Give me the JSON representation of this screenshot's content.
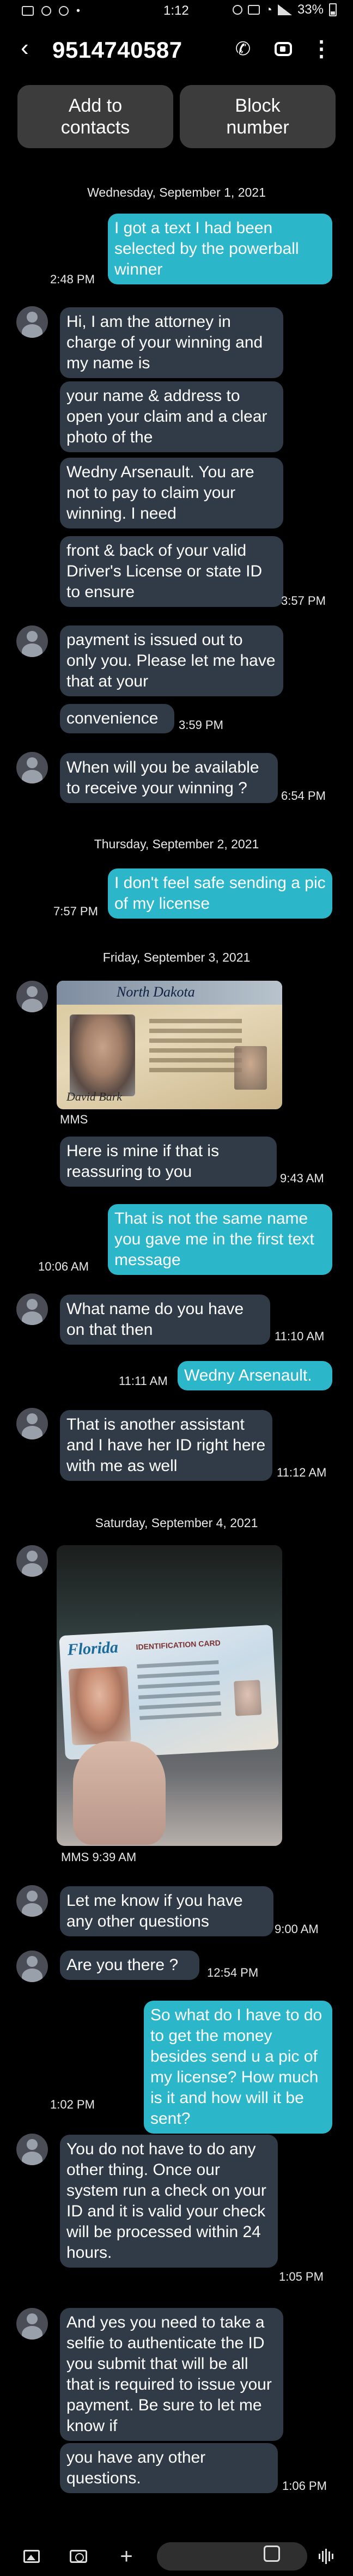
{
  "status_bar": {
    "time": "1:12",
    "battery": "33%"
  },
  "header": {
    "title": "9514740587",
    "add_to_contacts": "Add to contacts",
    "block_number": "Block number"
  },
  "dates": {
    "d1": "Wednesday, September 1, 2021",
    "d2": "Thursday, September 2, 2021",
    "d3": "Friday, September 3, 2021",
    "d4": "Saturday, September 4, 2021"
  },
  "messages": {
    "m1": "I got a text I had been selected by the powerball winner",
    "m1_time": "2:48 PM",
    "m2": "Hi, I am the attorney in charge of your winning and my name is",
    "m3": "your name & address to open your claim and a clear photo of the",
    "m4": "Wedny Arsenault. You are not to pay to claim your winning. I need",
    "m5": "front & back of your valid  Driver's License or state ID to ensure",
    "m5_time": "3:57 PM",
    "m6": "payment is issued out to only you. Please let me have that at your",
    "m7": "convenience",
    "m7_time": "3:59 PM",
    "m8": "When will you be available to receive your winning ?",
    "m8_time": "6:54 PM",
    "m9": "I don't feel safe sending a pic of my license",
    "m9_time": "7:57 PM",
    "mms1_label": "MMS",
    "m10": "Here is mine if that is reassuring to you",
    "m10_time": "9:43 AM",
    "m11": "That is not the same name you gave me in the first text message",
    "m11_time": "10:06 AM",
    "m12": "What name do you have on that then",
    "m12_time": "11:10 AM",
    "m13": "Wedny Arsenault.",
    "m13_time": "11:11 AM",
    "m14": "That is another assistant and I have her ID right here with me as well",
    "m14_time": "11:12 AM",
    "mms2_label": "MMS 9:39 AM",
    "m15": "Let me know if you have any other questions",
    "m15_time": "9:00 AM",
    "m16": "Are you there ?",
    "m16_time": "12:54 PM",
    "m17": "So what do I have to do to get the money besides send u a pic of my license?  How much is it and how will it be sent?",
    "m17_time": "1:02 PM",
    "m18": "You do not have to do any other thing. Once our system run a check on your ID and it is valid your check will be processed within 24 hours.",
    "m18_time": "1:05 PM",
    "m19": "And yes you need to take a selfie to authenticate the ID you submit that will be all that is required to issue your payment. Be sure to let me know if",
    "m20": "you have any other questions.",
    "m20_time": "1:06 PM"
  },
  "license1": {
    "state": "North Dakota"
  },
  "license2": {
    "state": "Florida",
    "card_type": "IDENTIFICATION CARD"
  }
}
